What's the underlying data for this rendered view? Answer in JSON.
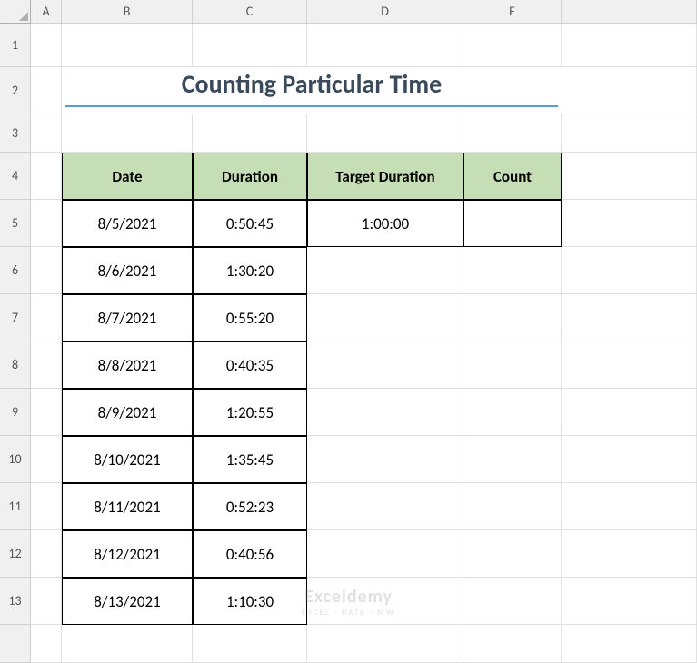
{
  "columns": [
    "",
    "A",
    "B",
    "C",
    "D",
    "E"
  ],
  "rows": [
    "1",
    "2",
    "3",
    "4",
    "5",
    "6",
    "7",
    "8",
    "9",
    "10",
    "11",
    "12",
    "13"
  ],
  "title": "Counting Particular Time",
  "headers": {
    "date": "Date",
    "duration": "Duration",
    "target": "Target Duration",
    "count": "Count"
  },
  "data": [
    {
      "date": "8/5/2021",
      "duration": "0:50:45"
    },
    {
      "date": "8/6/2021",
      "duration": "1:30:20"
    },
    {
      "date": "8/7/2021",
      "duration": "0:55:20"
    },
    {
      "date": "8/8/2021",
      "duration": "0:40:35"
    },
    {
      "date": "8/9/2021",
      "duration": "1:20:55"
    },
    {
      "date": "8/10/2021",
      "duration": "1:35:45"
    },
    {
      "date": "8/11/2021",
      "duration": "0:52:23"
    },
    {
      "date": "8/12/2021",
      "duration": "0:40:56"
    },
    {
      "date": "8/13/2021",
      "duration": "1:10:30"
    }
  ],
  "target_duration": "1:00:00",
  "count": "",
  "watermark": {
    "main": "Exceldemy",
    "sub": "EXCEL · DATA · MW"
  }
}
